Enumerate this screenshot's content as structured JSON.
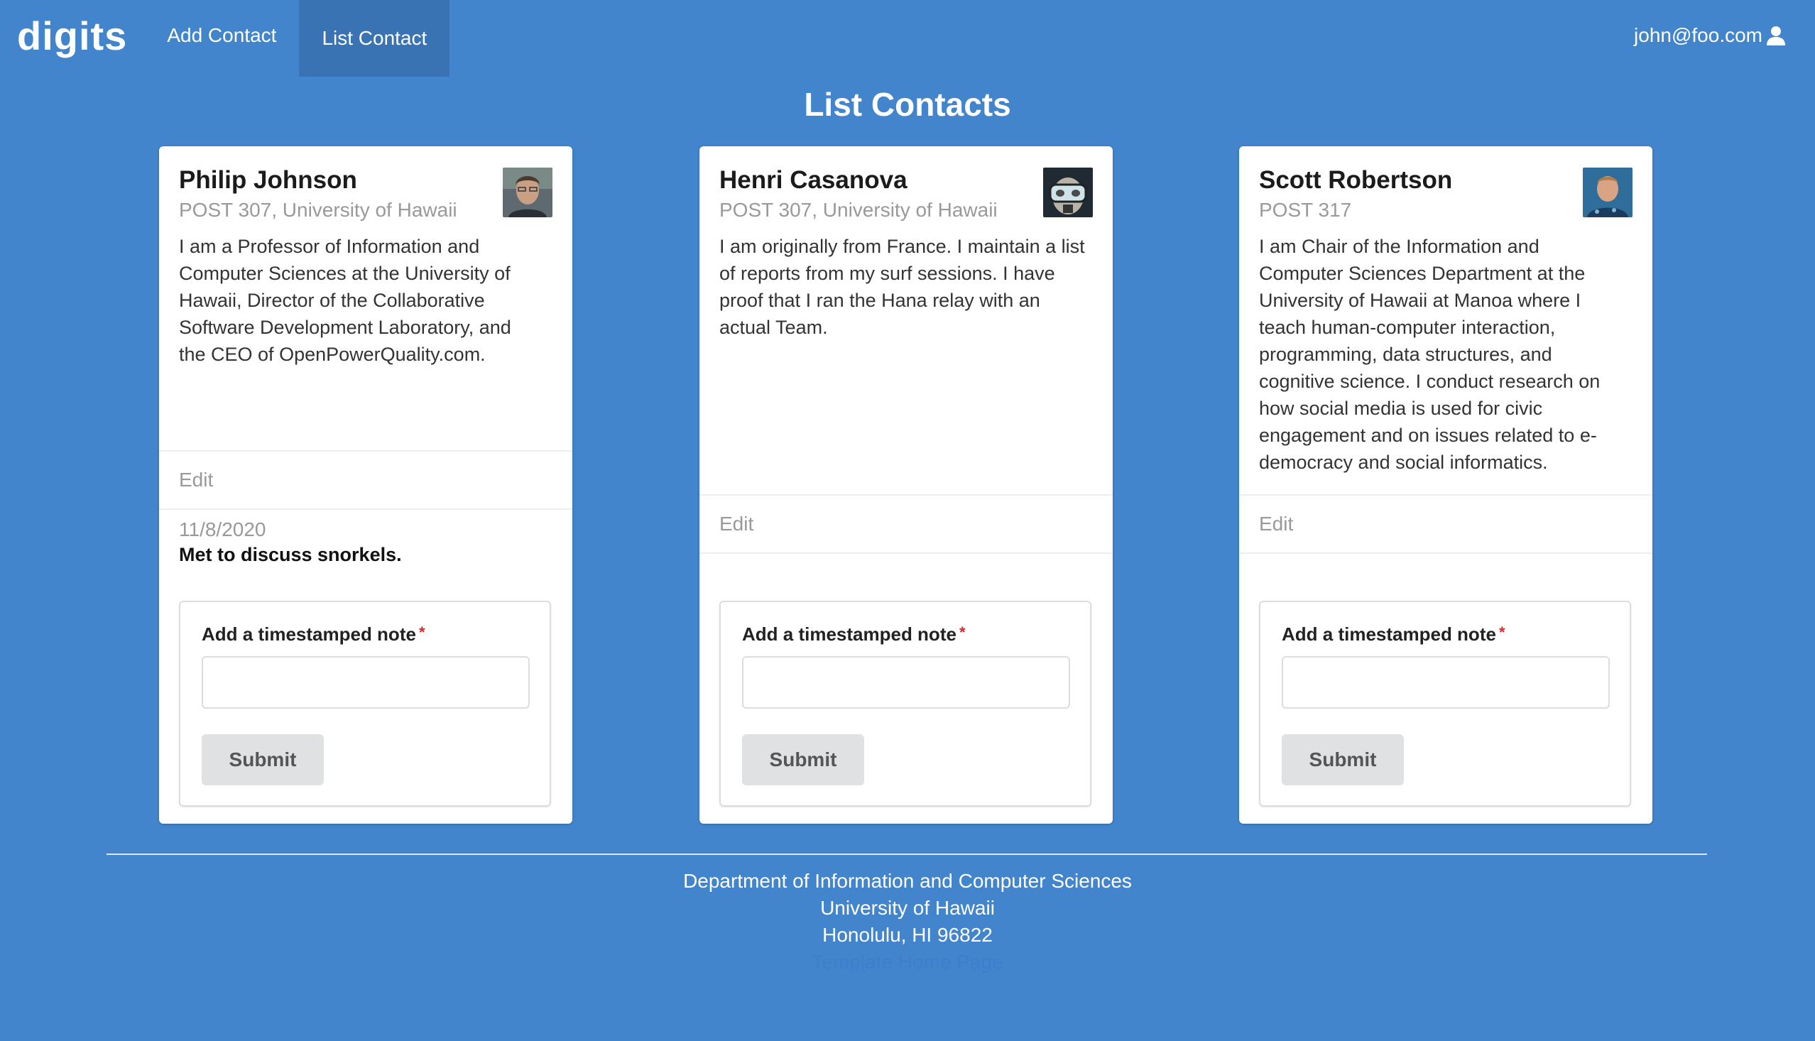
{
  "navbar": {
    "brand": "digits",
    "items": [
      {
        "label": "Add Contact",
        "active": false
      },
      {
        "label": "List Contact",
        "active": true
      }
    ],
    "user": "john@foo.com",
    "user_icon": "user-icon"
  },
  "page": {
    "title": "List Contacts"
  },
  "contacts": [
    {
      "name": "Philip Johnson",
      "address": "POST 307, University of Hawaii",
      "description": "I am a Professor of Information and Computer Sciences at the University of Hawaii, Director of the Collaborative Software Development Laboratory, and the CEO of OpenPowerQuality.com.",
      "edit_label": "Edit",
      "notes": [
        {
          "date": "11/8/2020",
          "text": "Met to discuss snorkels."
        }
      ],
      "form": {
        "label": "Add a timestamped note",
        "required": "*",
        "submit_label": "Submit",
        "value": ""
      }
    },
    {
      "name": "Henri Casanova",
      "address": "POST 307, University of Hawaii",
      "description": "I am originally from France. I maintain a list of reports from my surf sessions. I have proof that I ran the Hana relay with an actual Team.",
      "edit_label": "Edit",
      "notes": [],
      "form": {
        "label": "Add a timestamped note",
        "required": "*",
        "submit_label": "Submit",
        "value": ""
      }
    },
    {
      "name": "Scott Robertson",
      "address": "POST 317",
      "description": "I am Chair of the Information and Computer Sciences Department at the University of Hawaii at Manoa where I teach human-computer interaction, programming, data structures, and cognitive science. I conduct research on how social media is used for civic engagement and on issues related to e-democracy and social informatics.",
      "edit_label": "Edit",
      "notes": [],
      "form": {
        "label": "Add a timestamped note",
        "required": "*",
        "submit_label": "Submit",
        "value": ""
      }
    }
  ],
  "footer": {
    "line1": "Department of Information and Computer Sciences",
    "line2": "University of Hawaii",
    "line3": "Honolulu, HI 96822",
    "link": "Template Home Page"
  },
  "colors": {
    "background": "#4285cc",
    "nav_active": "#3a73b3",
    "required": "#db2828",
    "button": "#e0e1e2"
  }
}
